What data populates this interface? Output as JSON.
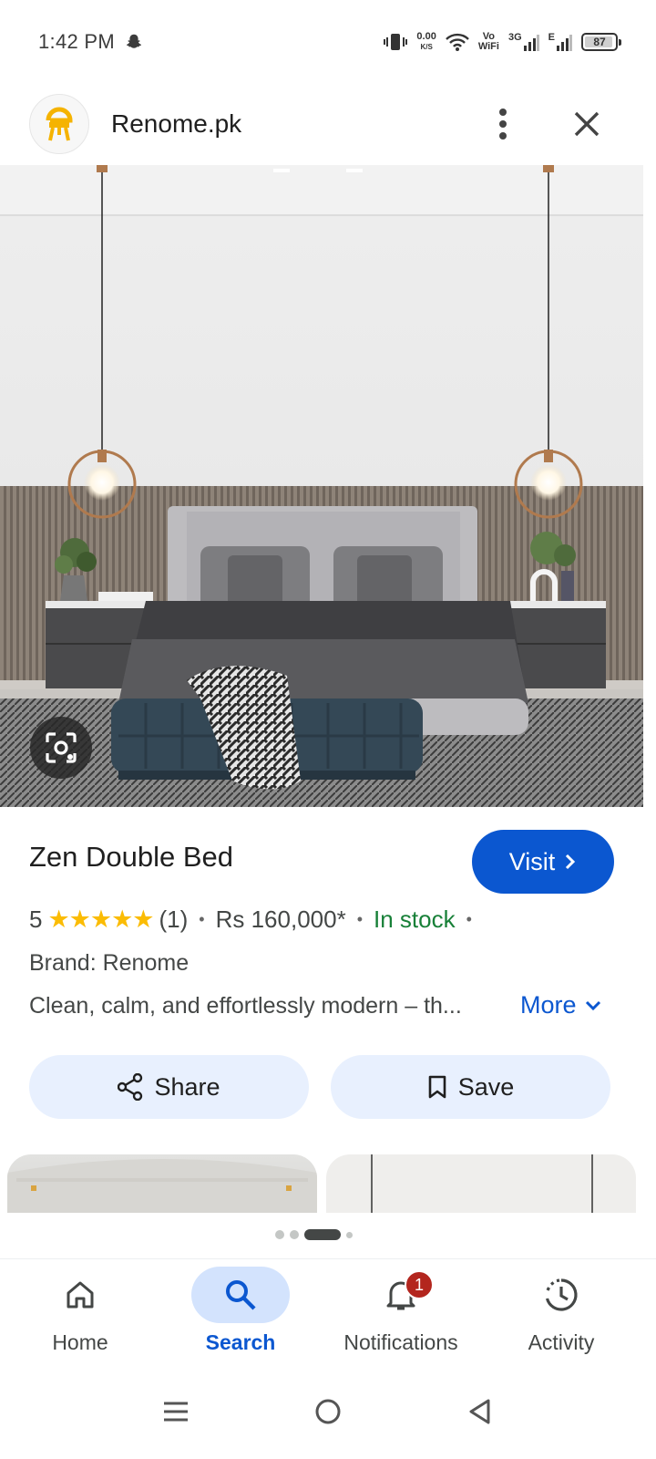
{
  "status_bar": {
    "time": "1:42 PM",
    "net_speed_value": "0.00",
    "net_speed_unit": "K/S",
    "vowifi_top": "Vo",
    "vowifi_bottom": "WiFi",
    "network_3g": "3G",
    "network_e": "E",
    "battery": "87"
  },
  "header": {
    "site_name": "Renome.pk"
  },
  "product": {
    "title": "Zen Double Bed",
    "visit_label": "Visit",
    "rating_value": "5",
    "stars": "★★★★★",
    "review_count": "(1)",
    "price": "Rs 160,000*",
    "availability": "In stock",
    "brand": "Brand: Renome",
    "description": "Clean, calm, and effortlessly modern – th...",
    "more_label": "More"
  },
  "actions": {
    "share_label": "Share",
    "save_label": "Save"
  },
  "carousel": {
    "page_count": 4,
    "active_index": 2
  },
  "bottom_nav": {
    "items": [
      {
        "label": "Home",
        "icon": "home-icon"
      },
      {
        "label": "Search",
        "icon": "search-icon",
        "active": true
      },
      {
        "label": "Notifications",
        "icon": "bell-icon",
        "badge": "1"
      },
      {
        "label": "Activity",
        "icon": "activity-icon"
      }
    ]
  },
  "colors": {
    "accent": "#0b57d0",
    "in_stock": "#188038",
    "star": "#fbbc04",
    "pill_bg": "#e8f0fe",
    "badge": "#b3261e"
  }
}
